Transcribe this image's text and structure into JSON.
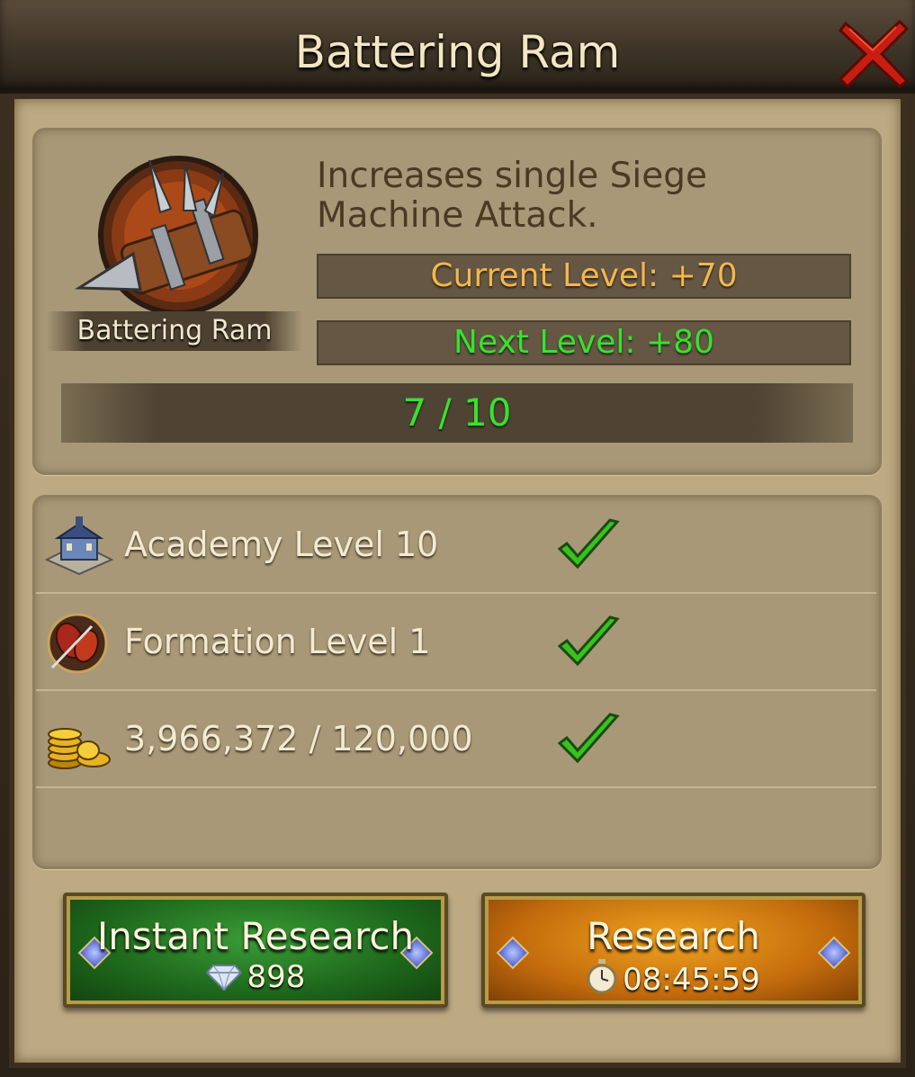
{
  "dialog": {
    "title": "Battering Ram",
    "close_label": "✕"
  },
  "research": {
    "name": "Battering Ram",
    "description": "Increases single Siege Machine Attack.",
    "current_level": "Current Level: +70",
    "next_level": "Next Level: +80",
    "progress_text": "7 / 10",
    "progress": {
      "current": 7,
      "max": 10
    }
  },
  "requirements": [
    {
      "label": "Academy Level 10",
      "icon": "academy-building-icon",
      "met": true
    },
    {
      "label": "Formation Level 1",
      "icon": "formation-icon",
      "met": true
    },
    {
      "label": "3,966,372 / 120,000",
      "icon": "gold-coins-icon",
      "met": true
    }
  ],
  "buttons": {
    "instant": {
      "label": "Instant Research",
      "cost": "898",
      "cost_icon": "gem-icon"
    },
    "research": {
      "label": "Research",
      "time": "08:45:59",
      "time_icon": "stopwatch-icon"
    }
  },
  "colors": {
    "current_level": "#f6b64a",
    "next_level": "#39e12c",
    "instant_button": "#2e8a2b",
    "research_button": "#d98414"
  }
}
